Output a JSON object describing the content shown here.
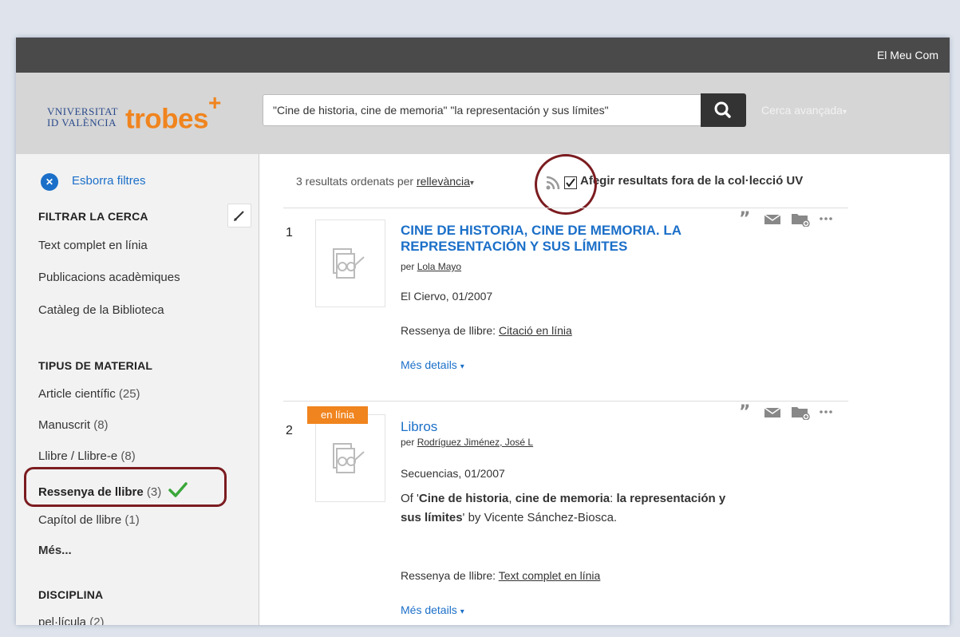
{
  "topbar": {
    "my_account": "El Meu Com"
  },
  "logo": {
    "university_line1": "VNIVERSITAT",
    "university_line2": "ID VALÈNCIA",
    "brand": "trobes",
    "plus": "+"
  },
  "search": {
    "query": "\"Cine de historia, cine de memoria\" \"la representación y sus límites\"",
    "advanced": "Cerca avançada"
  },
  "colors": {
    "accent_blue": "#1b6fc8",
    "brand_orange": "#f0841e",
    "topbar": "#4a4a4a",
    "annotation": "#7b1c20",
    "check_green": "#3aa63a"
  },
  "sidebar": {
    "clear_filters": "Esborra filtres",
    "filter_heading": "FILTRAR LA CERCA",
    "filter_items": [
      "Text complet en línia",
      "Publicacions acadèmiques",
      "Catàleg de la Biblioteca"
    ],
    "material_heading": "TIPUS DE MATERIAL",
    "material_items": [
      {
        "label": "Article científic",
        "count": "(25)"
      },
      {
        "label": "Manuscrit",
        "count": "(8)"
      },
      {
        "label": "Llibre / Llibre-e",
        "count": "(8)"
      },
      {
        "label": "Ressenya de llibre",
        "count": "(3)",
        "selected": true
      },
      {
        "label": "Capítol de llibre",
        "count": "(1)"
      }
    ],
    "more": "Més...",
    "discipline_heading": "DISCIPLINA",
    "discipline_items": [
      {
        "label": "pel·lícula",
        "count": "(2)"
      }
    ]
  },
  "results_bar": {
    "count_text": "3 resultats ordenats per",
    "sort": "rellevància",
    "include_outside": "Afegir resultats fora de la col·lecció UV",
    "include_checked": true
  },
  "results": [
    {
      "number": "1",
      "title": "CINE DE HISTORIA, CINE DE MEMORIA. LA REPRESENTACIÓN Y SUS LÍMITES",
      "by": "per",
      "author": "Lola Mayo",
      "source": "El Ciervo, 01/2007",
      "type_label": "Ressenya de llibre:",
      "type_link": "Citació en línia",
      "more": "Més details"
    },
    {
      "number": "2",
      "badge": "en línia",
      "title": "Libros",
      "by": "per",
      "author": "Rodríguez Jiménez, José L",
      "source": "Secuencias, 01/2007",
      "desc_prefix": "Of '",
      "desc_bold1": "Cine de historia",
      "desc_sep1": ", ",
      "desc_bold2": "cine de memoria",
      "desc_sep2": ": ",
      "desc_bold3": "la representación y sus límites",
      "desc_suffix": "' by Vicente Sánchez-Biosca.",
      "type_label": "Ressenya de llibre:",
      "type_link": "Text complet en línia",
      "more": "Més details"
    }
  ]
}
